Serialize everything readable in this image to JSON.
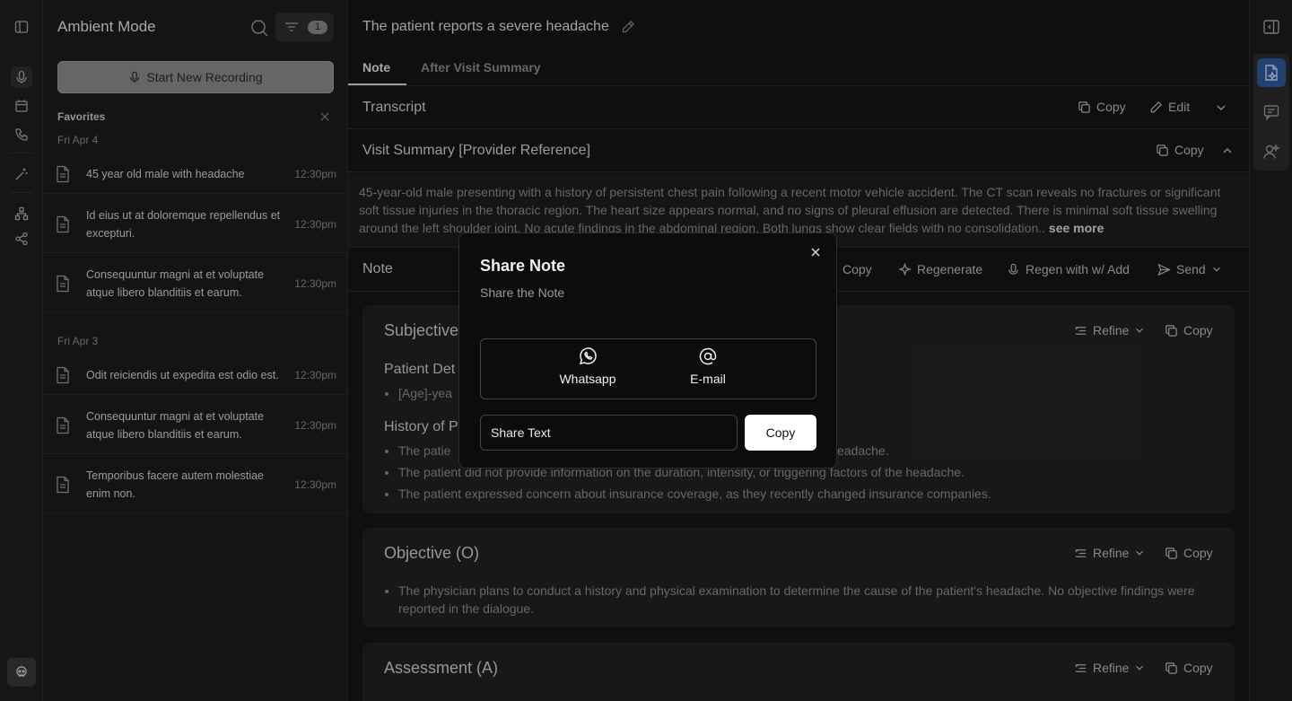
{
  "sidebar": {
    "title": "Ambient Mode",
    "filter_count": "1",
    "record_label": "Start New Recording",
    "favorites_label": "Favorites",
    "groups": [
      {
        "date": "Fri Apr 4",
        "items": [
          {
            "text": "45 year old male with headache",
            "time": "12:30pm"
          },
          {
            "text": "Id eius ut at doloremque repellendus et excepturi.",
            "time": "12:30pm"
          },
          {
            "text": "Consequuntur magni at et voluptate atque libero blanditiis et earum.",
            "time": "12:30pm"
          }
        ]
      },
      {
        "date": "Fri Apr 3",
        "items": [
          {
            "text": "Odit reiciendis ut expedita est odio est.",
            "time": "12:30pm"
          },
          {
            "text": "Consequuntur magni at et voluptate atque libero blanditiis et earum.",
            "time": "12:30pm"
          },
          {
            "text": "Temporibus facere autem molestiae enim non.",
            "time": "12:30pm"
          }
        ]
      }
    ]
  },
  "main": {
    "title": "The patient reports a severe headache",
    "tabs": [
      {
        "label": "Note"
      },
      {
        "label": "After Visit Summary"
      }
    ],
    "transcript": {
      "label": "Transcript",
      "copy": "Copy",
      "edit": "Edit"
    },
    "visit_summary": {
      "label": "Visit Summary [Provider Reference]",
      "copy": "Copy",
      "text": "45-year-old male presenting with a history of persistent chest pain following a recent motor vehicle accident. The CT scan reveals no fractures or significant soft tissue injuries in the thoracic region. The heart size appears normal, and no signs of pleural effusion are detected. There is minimal soft tissue swelling around the left shoulder joint. No acute findings in the abdominal region. Both lungs show clear fields with no consolidation..",
      "see_more": "see more"
    },
    "note_bar": {
      "label": "Note",
      "copy": "Copy",
      "regenerate": "Regenerate",
      "regen_add": "Regen with w/ Add",
      "send": "Send"
    },
    "sections": [
      {
        "title": "Subjective",
        "refine": "Refine",
        "copy": "Copy",
        "patient_details": "Patient Det",
        "pd_item": "[Age]-yea",
        "history": "History of P",
        "bullets": [
          "The patie",
          "The patient did not provide information on the duration, intensity, or triggering factors of the headache.",
          "The patient expressed concern about insurance coverage, as they recently changed insurance companies."
        ],
        "b1_tail": "eadache."
      },
      {
        "title": "Objective (O)",
        "refine": "Refine",
        "copy": "Copy",
        "bullets": [
          "The physician plans to conduct a history and physical examination to determine the cause of the patient's headache. No objective findings were reported in the dialogue."
        ]
      },
      {
        "title": "Assessment (A)",
        "refine": "Refine",
        "copy": "Copy"
      }
    ]
  },
  "modal": {
    "title": "Share Note",
    "subtitle": "Share the Note",
    "options": [
      {
        "label": "Whatsapp",
        "icon": "whatsapp-icon"
      },
      {
        "label": "E-mail",
        "icon": "at-sign-icon"
      }
    ],
    "share_text": "Share Text",
    "copy": "Copy"
  },
  "colors": {
    "accent": "#2d5b9e",
    "background": "#161616",
    "modal": "#0c0c0c"
  }
}
